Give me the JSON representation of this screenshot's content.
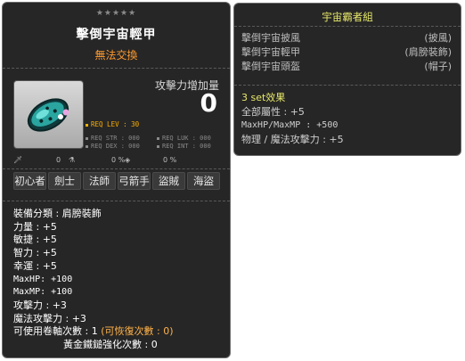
{
  "left": {
    "stars": "★★★★★",
    "item_name": "擊倒宇宙輕甲",
    "trade_status": "無法交換",
    "attack_increase_label": "攻擊力增加量",
    "attack_increase_value": "0",
    "req_lev": "REQ LEV : 30",
    "req_str": "REQ STR : 000",
    "req_dex": "REQ DEX : 000",
    "req_luk": "REQ LUK : 000",
    "req_int": "REQ INT : 000",
    "icon_values": [
      "0",
      "0 %",
      "0 %"
    ],
    "jobs": [
      "初心者",
      "劍士",
      "法師",
      "弓箭手",
      "盜賊",
      "海盜"
    ],
    "equip_type": "裝備分類 : 肩膀裝飾",
    "str": "力量 : +5",
    "dex": "敏捷 : +5",
    "int": "智力 : +5",
    "luk": "幸運 : +5",
    "maxhp": "MaxHP: +100",
    "maxmp": "MaxMP: +100",
    "att": "攻擊力 : +3",
    "matt": "魔法攻擊力 : +3",
    "upgrades_prefix": "可使用卷軸次數 : 1",
    "upgrades_recover": "(可恢復次數 : 0)",
    "hammer": "黃金鐵鎚強化次數 : 0"
  },
  "right": {
    "set_name": "宇宙霸者組",
    "items": [
      {
        "name": "擊倒宇宙披風",
        "slot": "(披風)"
      },
      {
        "name": "擊倒宇宙輕甲",
        "slot": "(肩膀裝飾)"
      },
      {
        "name": "擊倒宇宙頭盔",
        "slot": "(帽子)"
      }
    ],
    "effect_header": "3 set效果",
    "effect_all": "全部屬性 : +5",
    "effect_hpmp": "MaxHP/MaxMP : +500",
    "effect_atk": "物理 / 魔法攻擊力 : +5"
  },
  "colors": {
    "panel_bg": "#262626",
    "trade_orange": "#ff9a2e",
    "req_lev_yellow": "#ffb000",
    "set_title_yellow": "#e7e86a"
  }
}
